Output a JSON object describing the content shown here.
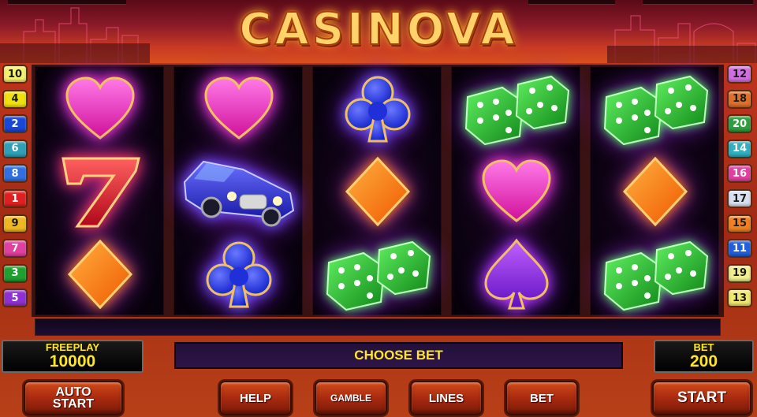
{
  "header": {
    "title": "CASINOVA"
  },
  "lines": {
    "left": [
      {
        "n": "10",
        "bg": "#f4f070",
        "fg": "#1a1a1a"
      },
      {
        "n": "4",
        "bg": "#f0e010",
        "fg": "#1a1a1a"
      },
      {
        "n": "2",
        "bg": "#1848d8",
        "fg": "#ffffff"
      },
      {
        "n": "6",
        "bg": "#30a0b8",
        "fg": "#ffffff"
      },
      {
        "n": "8",
        "bg": "#3070e0",
        "fg": "#ffffff"
      },
      {
        "n": "1",
        "bg": "#e02020",
        "fg": "#ffffff"
      },
      {
        "n": "9",
        "bg": "#f0b820",
        "fg": "#1a1a1a"
      },
      {
        "n": "7",
        "bg": "#e040a0",
        "fg": "#ffffff"
      },
      {
        "n": "3",
        "bg": "#20a030",
        "fg": "#ffffff"
      },
      {
        "n": "5",
        "bg": "#9030d0",
        "fg": "#ffffff"
      }
    ],
    "right": [
      {
        "n": "12",
        "bg": "#d070e0",
        "fg": "#1a1a1a"
      },
      {
        "n": "18",
        "bg": "#e07028",
        "fg": "#1a1a1a"
      },
      {
        "n": "20",
        "bg": "#30a040",
        "fg": "#ffffff"
      },
      {
        "n": "14",
        "bg": "#30b0c0",
        "fg": "#ffffff"
      },
      {
        "n": "16",
        "bg": "#e040a0",
        "fg": "#ffffff"
      },
      {
        "n": "17",
        "bg": "#d8e0f0",
        "fg": "#1a1a1a"
      },
      {
        "n": "15",
        "bg": "#f08020",
        "fg": "#1a1a1a"
      },
      {
        "n": "11",
        "bg": "#2060e0",
        "fg": "#ffffff"
      },
      {
        "n": "19",
        "bg": "#f0f090",
        "fg": "#1a1a1a"
      },
      {
        "n": "13",
        "bg": "#f0e870",
        "fg": "#1a1a1a"
      }
    ]
  },
  "reels": [
    [
      "heart-icon",
      "seven-icon",
      "diamond-icon"
    ],
    [
      "heart-icon",
      "car-icon",
      "club-icon"
    ],
    [
      "club-icon",
      "diamond-icon",
      "dice-icon"
    ],
    [
      "dice-icon",
      "heart-icon",
      "spade-icon"
    ],
    [
      "dice-icon",
      "diamond-icon",
      "dice-icon"
    ]
  ],
  "panel": {
    "freeplay_label": "FREEPLAY",
    "freeplay_value": "10000",
    "message": "CHOOSE BET",
    "bet_label": "BET",
    "bet_value": "200"
  },
  "buttons": {
    "auto_start_line1": "AUTO",
    "auto_start_line2": "START",
    "help": "HELP",
    "gamble": "GAMBLE",
    "lines": "LINES",
    "bet": "BET",
    "start": "START"
  },
  "colors": {
    "accent_yellow": "#ffe620",
    "button_red": "#a82a10",
    "title_gold": "#ffd36a"
  }
}
